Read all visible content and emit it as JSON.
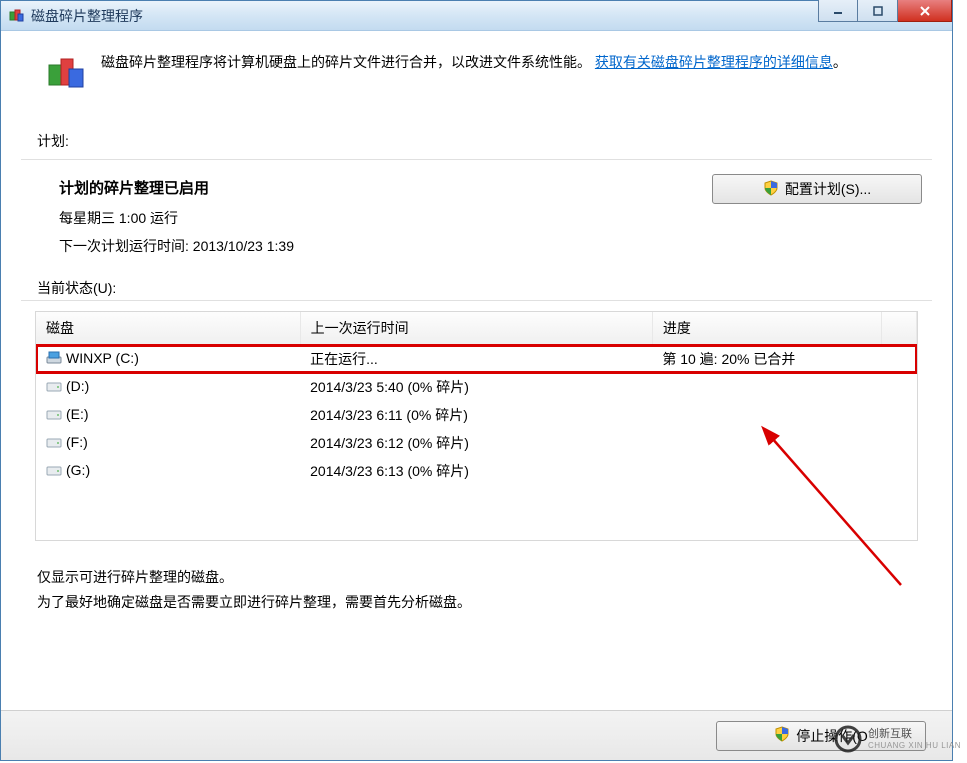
{
  "window": {
    "title": "磁盘碎片整理程序"
  },
  "header": {
    "description_pre": "磁盘碎片整理程序将计算机硬盘上的碎片文件进行合并，以改进文件系统性能。",
    "link_text": "获取有关磁盘碎片整理程序的详细信息",
    "period": "。"
  },
  "schedule": {
    "label": "计划:",
    "enabled_title": "计划的碎片整理已启用",
    "cadence": "每星期三   1:00 运行",
    "next_run": "下一次计划运行时间: 2013/10/23 1:39",
    "configure_btn": "配置计划(S)..."
  },
  "status": {
    "label": "当前状态(U):"
  },
  "table": {
    "col_disk": "磁盘",
    "col_lastrun": "上一次运行时间",
    "col_progress": "进度",
    "rows": [
      {
        "name": "WINXP (C:)",
        "lastrun": "正在运行...",
        "progress": "第 10 遍: 20% 已合并",
        "highlight": true,
        "sys": true
      },
      {
        "name": "(D:)",
        "lastrun": "2014/3/23 5:40 (0% 碎片)",
        "progress": ""
      },
      {
        "name": "(E:)",
        "lastrun": "2014/3/23 6:11 (0% 碎片)",
        "progress": ""
      },
      {
        "name": "(F:)",
        "lastrun": "2014/3/23 6:12 (0% 碎片)",
        "progress": ""
      },
      {
        "name": "(G:)",
        "lastrun": "2014/3/23 6:13 (0% 碎片)",
        "progress": ""
      }
    ]
  },
  "footnotes": {
    "line1": "仅显示可进行碎片整理的磁盘。",
    "line2": "为了最好地确定磁盘是否需要立即进行碎片整理，需要首先分析磁盘。"
  },
  "buttons": {
    "stop": "停止操作(O"
  },
  "watermark": {
    "main": "创新互联",
    "sub": "CHUANG XIN HU LIAN"
  }
}
